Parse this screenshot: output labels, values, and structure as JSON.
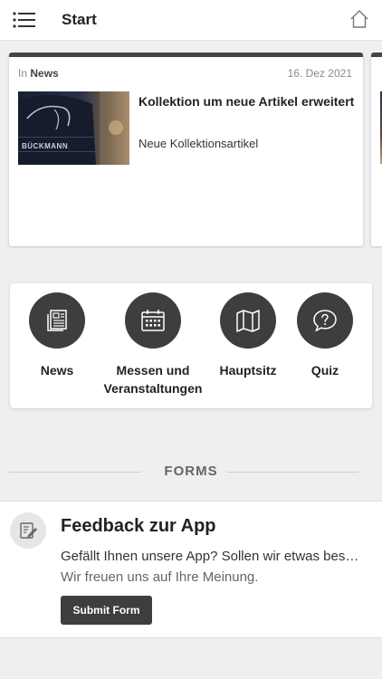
{
  "header": {
    "title": "Start",
    "menu_icon": "menu-list-icon",
    "home_icon": "home-icon"
  },
  "news_card": {
    "in_prefix": "In",
    "category": "News",
    "date": "16. Dez 2021",
    "title": "Kollektion um neue Artikel erweitert",
    "subtitle": "Neue Kollektionsartikel",
    "thumbnail_brand": "BÜCKMANN"
  },
  "shortcuts": [
    {
      "label": "News",
      "icon": "newspaper-icon"
    },
    {
      "label": "Messen und Veranstaltungen",
      "icon": "calendar-icon"
    },
    {
      "label": "Hauptsitz",
      "icon": "map-icon"
    },
    {
      "label": "Quiz",
      "icon": "question-bubble-icon"
    }
  ],
  "forms_section": {
    "heading": "FORMS"
  },
  "form": {
    "title": "Feedback zur App",
    "description": "Gefällt Ihnen unsere App? Sollen wir etwas besser machen?",
    "subtext": "Wir freuen uns auf Ihre Meinung.",
    "submit_label": "Submit Form",
    "icon": "edit-form-icon"
  },
  "colors": {
    "accent_dark": "#3e3e3e",
    "background": "#efeff1"
  }
}
